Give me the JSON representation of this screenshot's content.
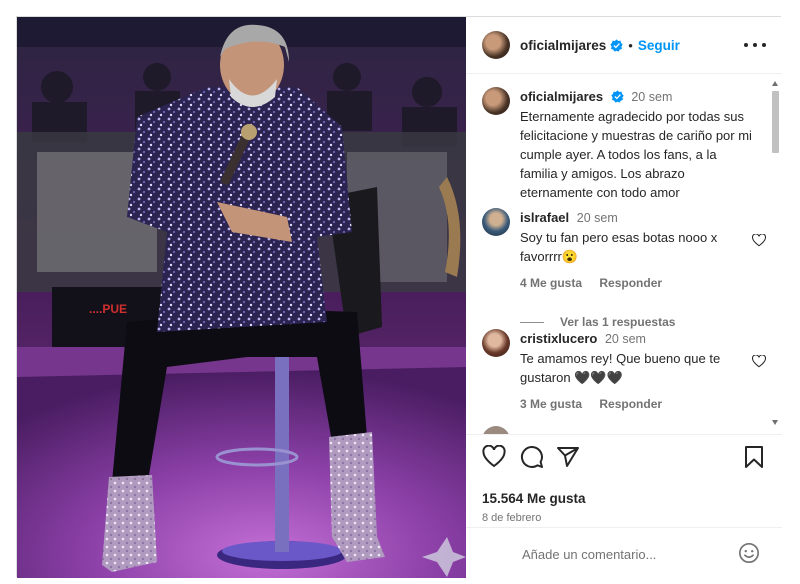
{
  "post": {
    "author": "oficialmijares",
    "follow_label": "Seguir",
    "dot": "•",
    "caption_time": "20 sem",
    "caption": "Eternamente agradecido por todas sus felicitacione y muestras de cariño por mi cumple ayer. A todos los fans, a la familia y amigos. Los abrazo eternamente con todo amor",
    "image_text": "....PUE",
    "likes": "15.564 Me gusta",
    "date": "8 de febrero"
  },
  "comments": [
    {
      "user": "islrafael",
      "time": "20 sem",
      "text": "Soy tu fan pero esas botas nooo x favorrrr😮",
      "likes": "4 Me gusta",
      "reply_label": "Responder",
      "view_replies": "Ver las 1 respuestas"
    },
    {
      "user": "cristixlucero",
      "time": "20 sem",
      "text": "Te amamos rey! Que bueno que te gustaron 🖤🖤🖤",
      "likes": "3 Me gusta",
      "reply_label": "Responder"
    }
  ],
  "add_comment": {
    "placeholder": "Añade un comentario..."
  },
  "icons": [
    "verified-icon",
    "more-options-icon",
    "heart-icon",
    "comment-icon",
    "share-icon",
    "bookmark-icon",
    "emoji-icon"
  ],
  "colors": {
    "accent": "#0095f6",
    "text": "#262626",
    "muted": "#737373",
    "border": "#dbdbdb"
  }
}
